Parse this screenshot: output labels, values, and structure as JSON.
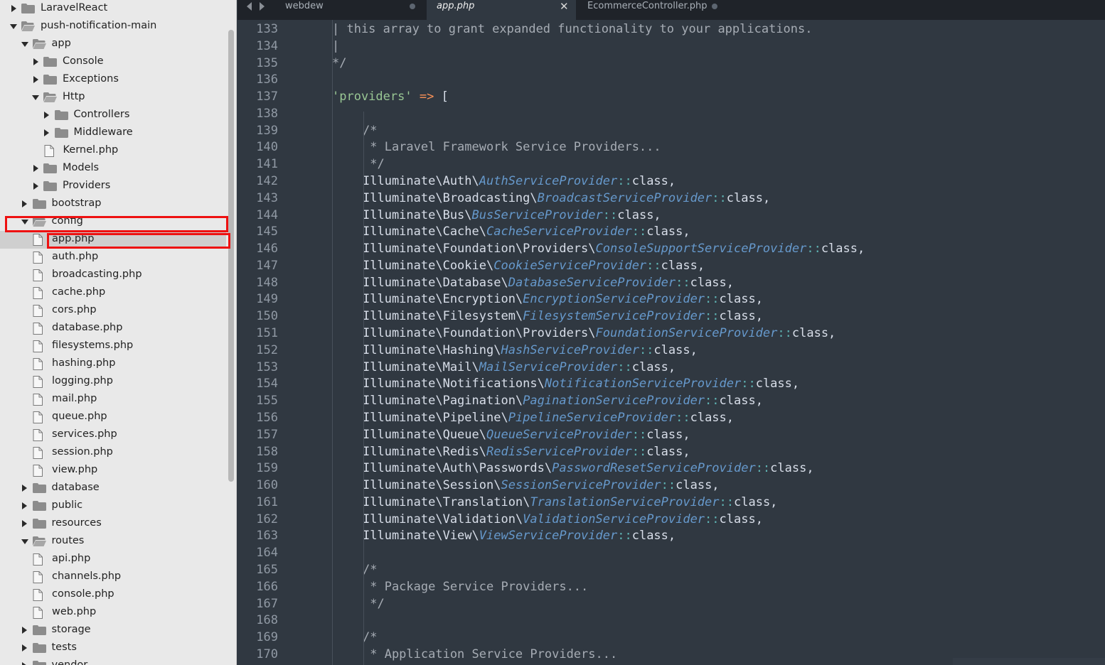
{
  "sidebar": {
    "items": [
      {
        "label": "LaravelReact",
        "kind": "folder",
        "depth": 0,
        "expanded": false
      },
      {
        "label": "push-notification-main",
        "kind": "folder",
        "depth": 0,
        "expanded": true
      },
      {
        "label": "app",
        "kind": "folder",
        "depth": 1,
        "expanded": true
      },
      {
        "label": "Console",
        "kind": "folder",
        "depth": 2,
        "expanded": false
      },
      {
        "label": "Exceptions",
        "kind": "folder",
        "depth": 2,
        "expanded": false
      },
      {
        "label": "Http",
        "kind": "folder",
        "depth": 2,
        "expanded": true
      },
      {
        "label": "Controllers",
        "kind": "folder",
        "depth": 3,
        "expanded": false
      },
      {
        "label": "Middleware",
        "kind": "folder",
        "depth": 3,
        "expanded": false
      },
      {
        "label": "Kernel.php",
        "kind": "file",
        "depth": 3
      },
      {
        "label": "Models",
        "kind": "folder",
        "depth": 2,
        "expanded": false
      },
      {
        "label": "Providers",
        "kind": "folder",
        "depth": 2,
        "expanded": false
      },
      {
        "label": "bootstrap",
        "kind": "folder",
        "depth": 1,
        "expanded": false
      },
      {
        "label": "config",
        "kind": "folder",
        "depth": 1,
        "expanded": true
      },
      {
        "label": "app.php",
        "kind": "file",
        "depth": 2,
        "selected": true
      },
      {
        "label": "auth.php",
        "kind": "file",
        "depth": 2
      },
      {
        "label": "broadcasting.php",
        "kind": "file",
        "depth": 2
      },
      {
        "label": "cache.php",
        "kind": "file",
        "depth": 2
      },
      {
        "label": "cors.php",
        "kind": "file",
        "depth": 2
      },
      {
        "label": "database.php",
        "kind": "file",
        "depth": 2
      },
      {
        "label": "filesystems.php",
        "kind": "file",
        "depth": 2
      },
      {
        "label": "hashing.php",
        "kind": "file",
        "depth": 2
      },
      {
        "label": "logging.php",
        "kind": "file",
        "depth": 2
      },
      {
        "label": "mail.php",
        "kind": "file",
        "depth": 2
      },
      {
        "label": "queue.php",
        "kind": "file",
        "depth": 2
      },
      {
        "label": "services.php",
        "kind": "file",
        "depth": 2
      },
      {
        "label": "session.php",
        "kind": "file",
        "depth": 2
      },
      {
        "label": "view.php",
        "kind": "file",
        "depth": 2
      },
      {
        "label": "database",
        "kind": "folder",
        "depth": 1,
        "expanded": false
      },
      {
        "label": "public",
        "kind": "folder",
        "depth": 1,
        "expanded": false
      },
      {
        "label": "resources",
        "kind": "folder",
        "depth": 1,
        "expanded": false
      },
      {
        "label": "routes",
        "kind": "folder",
        "depth": 1,
        "expanded": true
      },
      {
        "label": "api.php",
        "kind": "file",
        "depth": 2
      },
      {
        "label": "channels.php",
        "kind": "file",
        "depth": 2
      },
      {
        "label": "console.php",
        "kind": "file",
        "depth": 2
      },
      {
        "label": "web.php",
        "kind": "file",
        "depth": 2
      },
      {
        "label": "storage",
        "kind": "folder",
        "depth": 1,
        "expanded": false
      },
      {
        "label": "tests",
        "kind": "folder",
        "depth": 1,
        "expanded": false
      },
      {
        "label": "vendor",
        "kind": "folder",
        "depth": 1,
        "expanded": false
      }
    ]
  },
  "tabs": [
    {
      "label": "webdew",
      "active": false,
      "modified": true
    },
    {
      "label": "app.php",
      "active": true,
      "close": "✕"
    },
    {
      "label": "EcommerceController.php",
      "active": false,
      "modified": true
    }
  ],
  "editor": {
    "lines": [
      {
        "n": "133",
        "tokens": [
          [
            "comment",
            "| this array to grant expanded functionality to your applications."
          ]
        ],
        "indent": 1
      },
      {
        "n": "134",
        "tokens": [
          [
            "comment",
            "|"
          ]
        ],
        "indent": 1
      },
      {
        "n": "135",
        "tokens": [
          [
            "comment",
            "*/"
          ]
        ],
        "indent": 1
      },
      {
        "n": "136",
        "tokens": [],
        "indent": 0
      },
      {
        "n": "137",
        "tokens": [
          [
            "string",
            "'providers'"
          ],
          [
            "punct",
            " "
          ],
          [
            "op",
            "=>"
          ],
          [
            "punct",
            " ["
          ]
        ],
        "indent": 1
      },
      {
        "n": "138",
        "tokens": [],
        "indent": 0
      },
      {
        "n": "139",
        "tokens": [
          [
            "comment",
            "/*"
          ]
        ],
        "indent": 2
      },
      {
        "n": "140",
        "tokens": [
          [
            "comment",
            " * Laravel Framework Service Providers..."
          ]
        ],
        "indent": 2
      },
      {
        "n": "141",
        "tokens": [
          [
            "comment",
            " */"
          ]
        ],
        "indent": 2
      },
      {
        "n": "142",
        "tokens": [
          [
            "ns",
            "Illuminate\\Auth\\"
          ],
          [
            "cls",
            "AuthServiceProvider"
          ],
          [
            "sep",
            "::"
          ],
          [
            "kw",
            "class,"
          ]
        ],
        "indent": 2
      },
      {
        "n": "143",
        "tokens": [
          [
            "ns",
            "Illuminate\\Broadcasting\\"
          ],
          [
            "cls",
            "BroadcastServiceProvider"
          ],
          [
            "sep",
            "::"
          ],
          [
            "kw",
            "class,"
          ]
        ],
        "indent": 2
      },
      {
        "n": "144",
        "tokens": [
          [
            "ns",
            "Illuminate\\Bus\\"
          ],
          [
            "cls",
            "BusServiceProvider"
          ],
          [
            "sep",
            "::"
          ],
          [
            "kw",
            "class,"
          ]
        ],
        "indent": 2
      },
      {
        "n": "145",
        "tokens": [
          [
            "ns",
            "Illuminate\\Cache\\"
          ],
          [
            "cls",
            "CacheServiceProvider"
          ],
          [
            "sep",
            "::"
          ],
          [
            "kw",
            "class,"
          ]
        ],
        "indent": 2
      },
      {
        "n": "146",
        "tokens": [
          [
            "ns",
            "Illuminate\\Foundation\\Providers\\"
          ],
          [
            "cls",
            "ConsoleSupportServiceProvider"
          ],
          [
            "sep",
            "::"
          ],
          [
            "kw",
            "class,"
          ]
        ],
        "indent": 2
      },
      {
        "n": "147",
        "tokens": [
          [
            "ns",
            "Illuminate\\Cookie\\"
          ],
          [
            "cls",
            "CookieServiceProvider"
          ],
          [
            "sep",
            "::"
          ],
          [
            "kw",
            "class,"
          ]
        ],
        "indent": 2
      },
      {
        "n": "148",
        "tokens": [
          [
            "ns",
            "Illuminate\\Database\\"
          ],
          [
            "cls",
            "DatabaseServiceProvider"
          ],
          [
            "sep",
            "::"
          ],
          [
            "kw",
            "class,"
          ]
        ],
        "indent": 2
      },
      {
        "n": "149",
        "tokens": [
          [
            "ns",
            "Illuminate\\Encryption\\"
          ],
          [
            "cls",
            "EncryptionServiceProvider"
          ],
          [
            "sep",
            "::"
          ],
          [
            "kw",
            "class,"
          ]
        ],
        "indent": 2
      },
      {
        "n": "150",
        "tokens": [
          [
            "ns",
            "Illuminate\\Filesystem\\"
          ],
          [
            "cls",
            "FilesystemServiceProvider"
          ],
          [
            "sep",
            "::"
          ],
          [
            "kw",
            "class,"
          ]
        ],
        "indent": 2
      },
      {
        "n": "151",
        "tokens": [
          [
            "ns",
            "Illuminate\\Foundation\\Providers\\"
          ],
          [
            "cls",
            "FoundationServiceProvider"
          ],
          [
            "sep",
            "::"
          ],
          [
            "kw",
            "class,"
          ]
        ],
        "indent": 2
      },
      {
        "n": "152",
        "tokens": [
          [
            "ns",
            "Illuminate\\Hashing\\"
          ],
          [
            "cls",
            "HashServiceProvider"
          ],
          [
            "sep",
            "::"
          ],
          [
            "kw",
            "class,"
          ]
        ],
        "indent": 2
      },
      {
        "n": "153",
        "tokens": [
          [
            "ns",
            "Illuminate\\Mail\\"
          ],
          [
            "cls",
            "MailServiceProvider"
          ],
          [
            "sep",
            "::"
          ],
          [
            "kw",
            "class,"
          ]
        ],
        "indent": 2
      },
      {
        "n": "154",
        "tokens": [
          [
            "ns",
            "Illuminate\\Notifications\\"
          ],
          [
            "cls",
            "NotificationServiceProvider"
          ],
          [
            "sep",
            "::"
          ],
          [
            "kw",
            "class,"
          ]
        ],
        "indent": 2
      },
      {
        "n": "155",
        "tokens": [
          [
            "ns",
            "Illuminate\\Pagination\\"
          ],
          [
            "cls",
            "PaginationServiceProvider"
          ],
          [
            "sep",
            "::"
          ],
          [
            "kw",
            "class,"
          ]
        ],
        "indent": 2
      },
      {
        "n": "156",
        "tokens": [
          [
            "ns",
            "Illuminate\\Pipeline\\"
          ],
          [
            "cls",
            "PipelineServiceProvider"
          ],
          [
            "sep",
            "::"
          ],
          [
            "kw",
            "class,"
          ]
        ],
        "indent": 2
      },
      {
        "n": "157",
        "tokens": [
          [
            "ns",
            "Illuminate\\Queue\\"
          ],
          [
            "cls",
            "QueueServiceProvider"
          ],
          [
            "sep",
            "::"
          ],
          [
            "kw",
            "class,"
          ]
        ],
        "indent": 2
      },
      {
        "n": "158",
        "tokens": [
          [
            "ns",
            "Illuminate\\Redis\\"
          ],
          [
            "cls",
            "RedisServiceProvider"
          ],
          [
            "sep",
            "::"
          ],
          [
            "kw",
            "class,"
          ]
        ],
        "indent": 2
      },
      {
        "n": "159",
        "tokens": [
          [
            "ns",
            "Illuminate\\Auth\\Passwords\\"
          ],
          [
            "cls",
            "PasswordResetServiceProvider"
          ],
          [
            "sep",
            "::"
          ],
          [
            "kw",
            "class,"
          ]
        ],
        "indent": 2
      },
      {
        "n": "160",
        "tokens": [
          [
            "ns",
            "Illuminate\\Session\\"
          ],
          [
            "cls",
            "SessionServiceProvider"
          ],
          [
            "sep",
            "::"
          ],
          [
            "kw",
            "class,"
          ]
        ],
        "indent": 2
      },
      {
        "n": "161",
        "tokens": [
          [
            "ns",
            "Illuminate\\Translation\\"
          ],
          [
            "cls",
            "TranslationServiceProvider"
          ],
          [
            "sep",
            "::"
          ],
          [
            "kw",
            "class,"
          ]
        ],
        "indent": 2
      },
      {
        "n": "162",
        "tokens": [
          [
            "ns",
            "Illuminate\\Validation\\"
          ],
          [
            "cls",
            "ValidationServiceProvider"
          ],
          [
            "sep",
            "::"
          ],
          [
            "kw",
            "class,"
          ]
        ],
        "indent": 2
      },
      {
        "n": "163",
        "tokens": [
          [
            "ns",
            "Illuminate\\View\\"
          ],
          [
            "cls",
            "ViewServiceProvider"
          ],
          [
            "sep",
            "::"
          ],
          [
            "kw",
            "class,"
          ]
        ],
        "indent": 2
      },
      {
        "n": "164",
        "tokens": [],
        "indent": 0
      },
      {
        "n": "165",
        "tokens": [
          [
            "comment",
            "/*"
          ]
        ],
        "indent": 2
      },
      {
        "n": "166",
        "tokens": [
          [
            "comment",
            " * Package Service Providers..."
          ]
        ],
        "indent": 2
      },
      {
        "n": "167",
        "tokens": [
          [
            "comment",
            " */"
          ]
        ],
        "indent": 2
      },
      {
        "n": "168",
        "tokens": [],
        "indent": 0
      },
      {
        "n": "169",
        "tokens": [
          [
            "comment",
            "/*"
          ]
        ],
        "indent": 2
      },
      {
        "n": "170",
        "tokens": [
          [
            "comment",
            " * Application Service Providers..."
          ]
        ],
        "indent": 2
      }
    ]
  },
  "colors": {
    "editor_bg": "#303841",
    "sidebar_bg": "#e9e9e9",
    "highlight_box": "#ee1111",
    "string": "#99c794",
    "operator": "#f99157",
    "class_name": "#6699cc",
    "separator": "#5fb3b3",
    "comment": "#a6acb4"
  },
  "icons": {
    "folder": "folder-icon",
    "file": "file-icon",
    "expand": "triangle-down-icon",
    "collapse": "triangle-right-icon"
  }
}
